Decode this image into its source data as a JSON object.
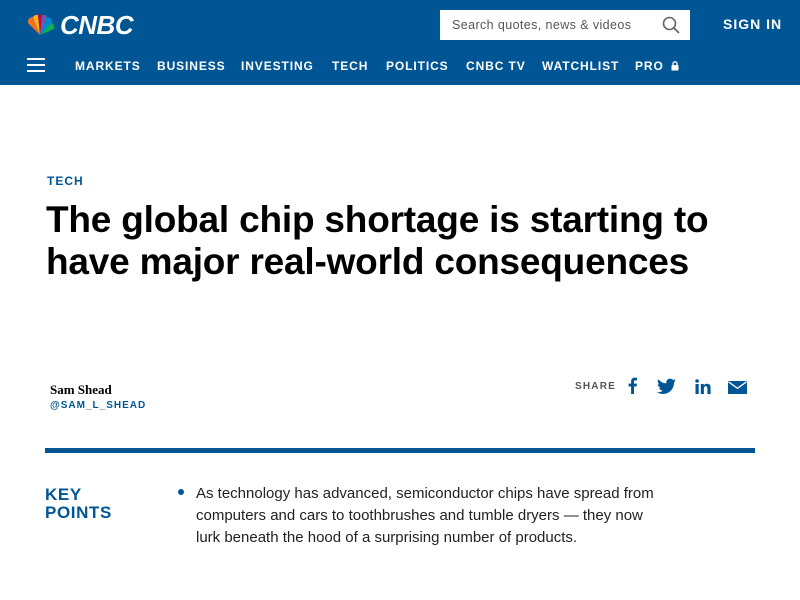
{
  "header": {
    "logo_text": "CNBC",
    "search": {
      "placeholder": "Search quotes, news & videos",
      "value": ""
    },
    "sign_in": "SIGN IN",
    "nav_items": [
      "MARKETS",
      "BUSINESS",
      "INVESTING",
      "TECH",
      "POLITICS",
      "CNBC TV",
      "WATCHLIST",
      "PRO"
    ],
    "colors": {
      "brand_blue": "#005594"
    }
  },
  "article": {
    "kicker": "TECH",
    "headline": "The global chip shortage is starting to have major real-world consequences",
    "author": {
      "name": "Sam Shead",
      "handle": "@SAM_L_SHEAD"
    },
    "share": {
      "label": "SHARE",
      "icons": [
        "facebook-icon",
        "twitter-icon",
        "linkedin-icon",
        "email-icon"
      ]
    },
    "key_points": {
      "title": "KEY POINTS",
      "items": [
        "As technology has advanced, semiconductor chips have spread from computers and cars to toothbrushes and tumble dryers — they now lurk beneath the hood of a surprising number of products."
      ]
    }
  }
}
